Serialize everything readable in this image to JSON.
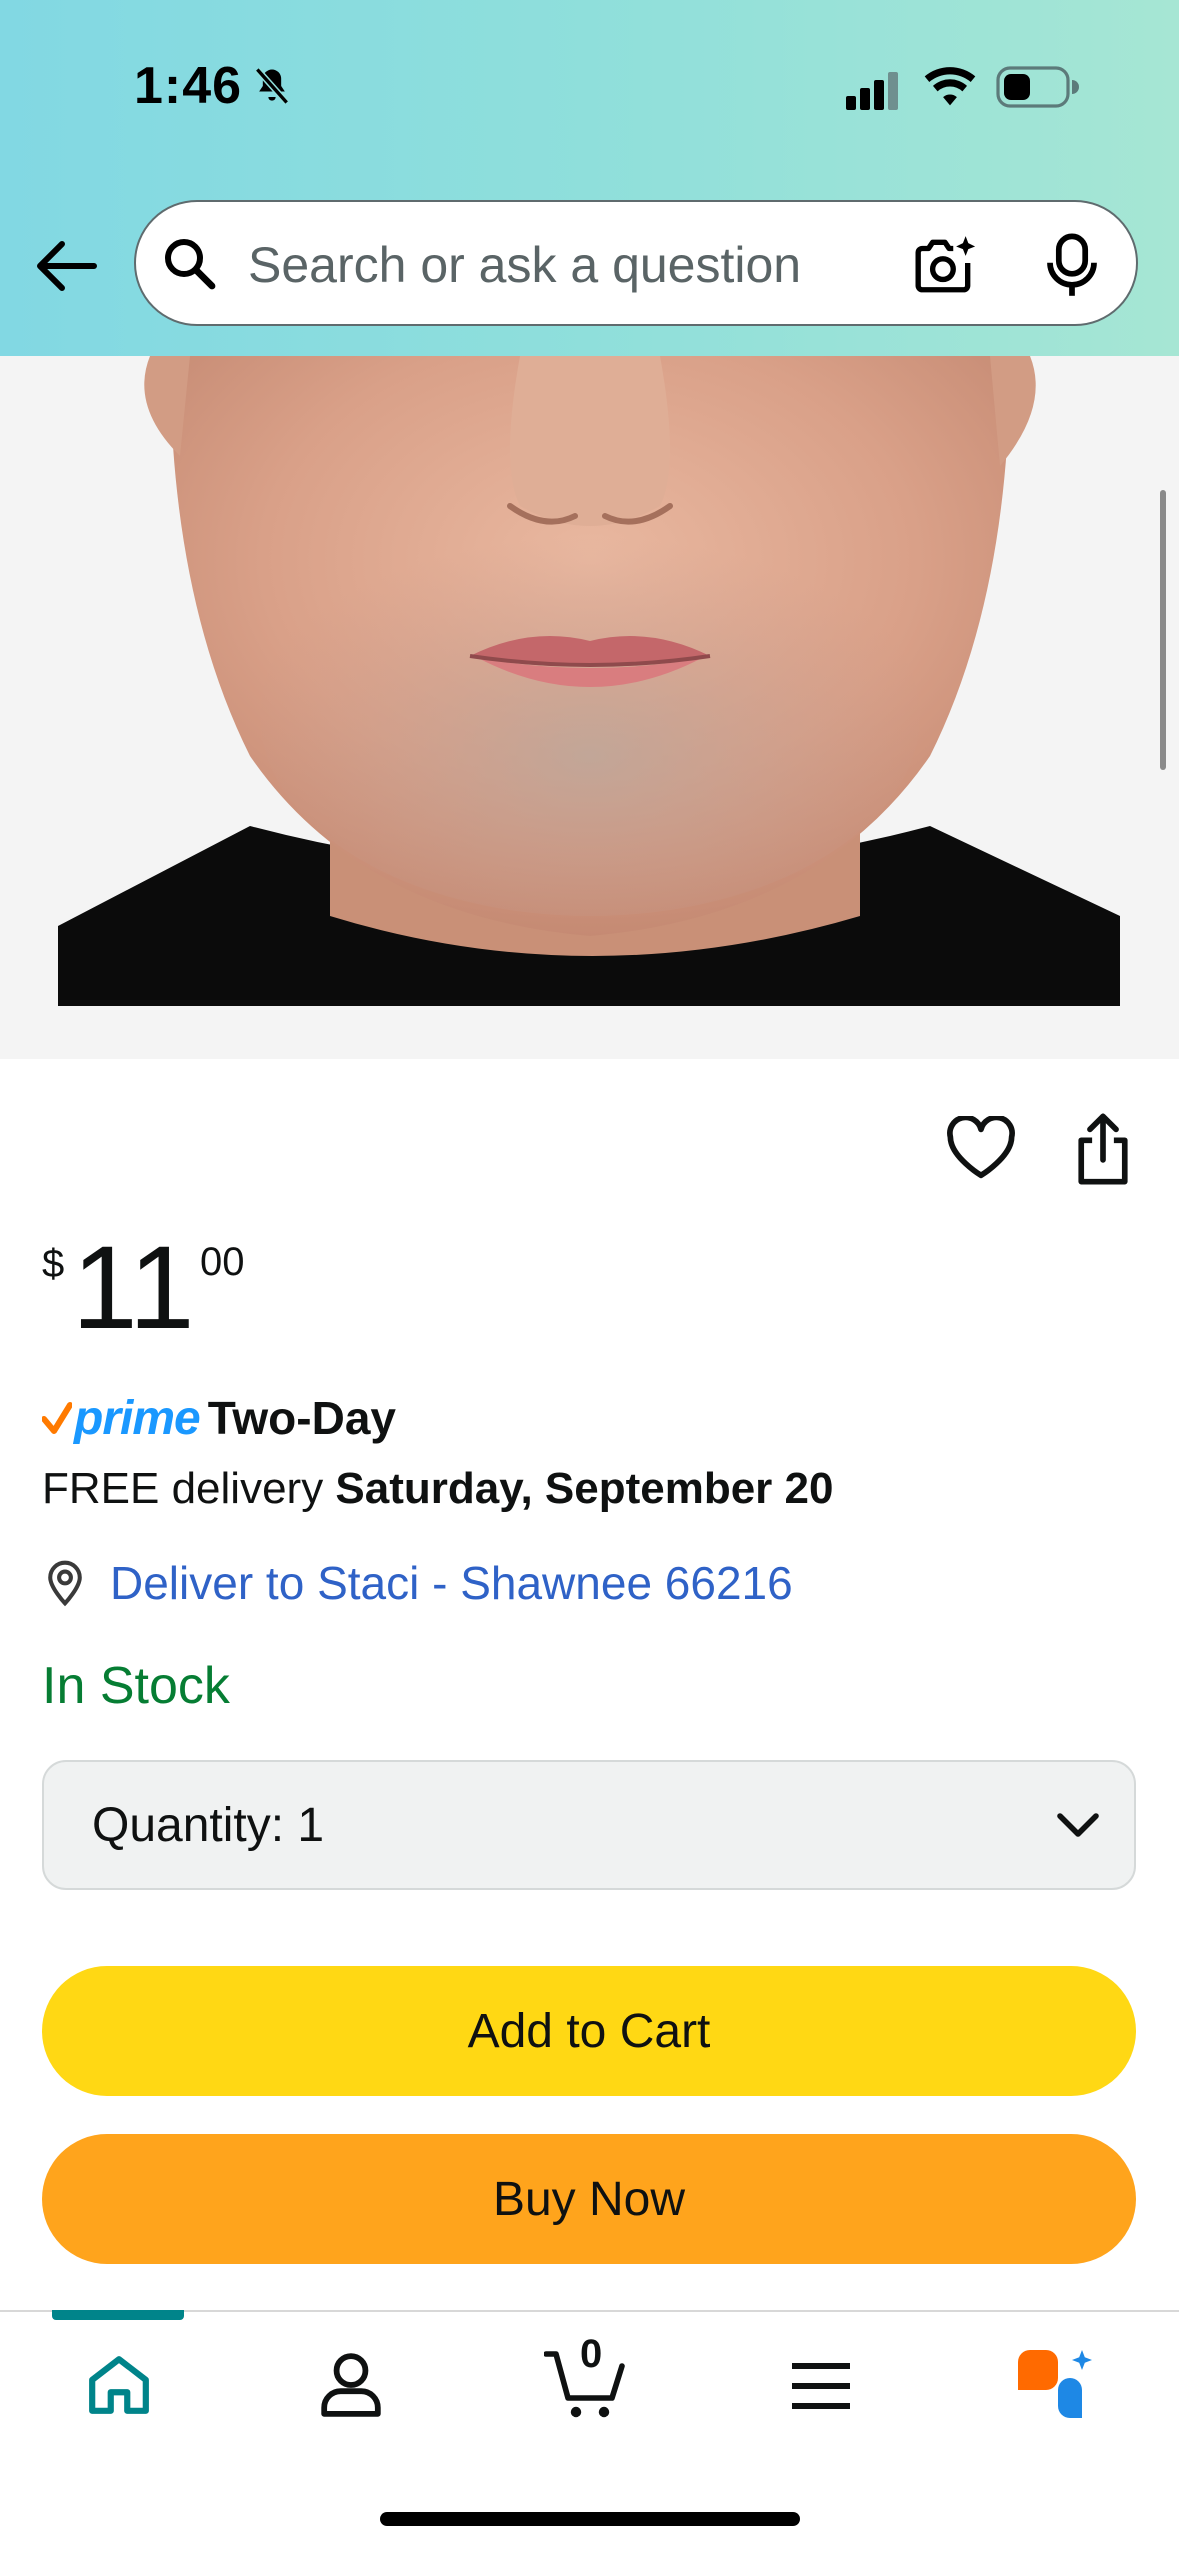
{
  "status_bar": {
    "time": "1:46"
  },
  "search": {
    "placeholder": "Search or ask a question"
  },
  "product": {
    "price": {
      "currency": "$",
      "whole": "11",
      "fraction": "00"
    },
    "prime": {
      "brand": "prime",
      "label": "Two-Day"
    },
    "delivery": {
      "prefix": "FREE delivery",
      "date": "Saturday, September 20"
    },
    "deliver_to": "Deliver to Staci - Shawnee 66216",
    "stock_status": "In Stock",
    "quantity_label": "Quantity:  1"
  },
  "buttons": {
    "add_to_cart": "Add to Cart",
    "buy_now": "Buy Now"
  },
  "nav": {
    "cart_count": "0"
  },
  "colors": {
    "header_gradient": [
      "#82d8e3",
      "#a6e6d4"
    ],
    "add_to_cart": "#ffd814",
    "buy_now": "#ffa41c",
    "in_stock": "#067d33",
    "link": "#2f62c7",
    "prime_blue": "#1a98ff",
    "nav_active": "#00848a"
  },
  "icons": [
    "bell-off-icon",
    "signal-icon",
    "wifi-icon",
    "battery-icon",
    "back-arrow-icon",
    "search-icon",
    "camera-icon",
    "microphone-icon",
    "heart-icon",
    "share-icon",
    "location-pin-icon",
    "chevron-down-icon",
    "home-icon",
    "account-icon",
    "cart-icon",
    "menu-icon",
    "rufus-icon"
  ]
}
